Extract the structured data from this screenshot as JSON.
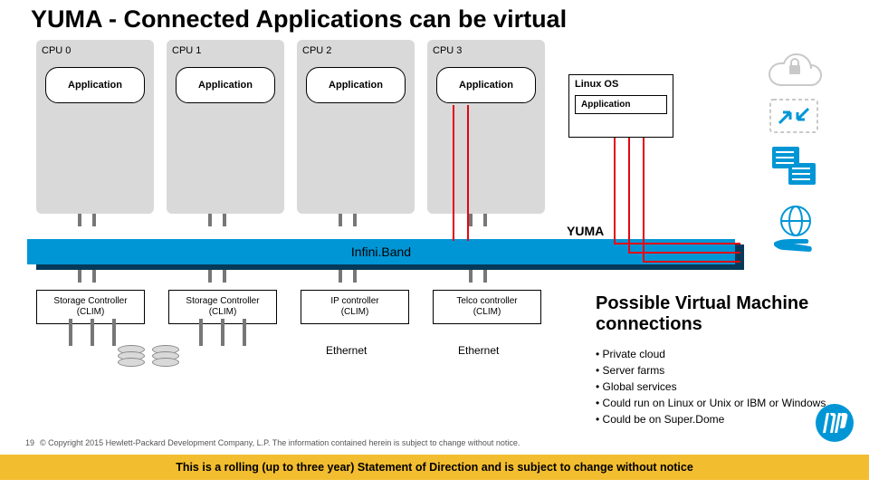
{
  "title": "YUMA - Connected Applications can be virtual",
  "cpus": [
    {
      "label": "CPU 0",
      "app": "Application"
    },
    {
      "label": "CPU 1",
      "app": "Application"
    },
    {
      "label": "CPU 2",
      "app": "Application"
    },
    {
      "label": "CPU 3",
      "app": "Application"
    }
  ],
  "linux": {
    "os": "Linux OS",
    "app": "Application"
  },
  "yuma_label": "YUMA",
  "bus_label": "Infini.Band",
  "controllers": [
    {
      "line1": "Storage Controller",
      "line2": "(CLIM)"
    },
    {
      "line1": "Storage Controller",
      "line2": "(CLIM)"
    },
    {
      "line1": "IP  controller",
      "line2": "(CLIM)"
    },
    {
      "line1": "Telco  controller",
      "line2": "(CLIM)"
    }
  ],
  "ethernet_label": "Ethernet",
  "pvm_heading": "Possible Virtual Machine connections",
  "bullets": [
    "Private cloud",
    "Server farms",
    "Global services",
    "Could run on Linux or Unix or IBM or Windows",
    "Could be on Super.Dome"
  ],
  "page_number": "19",
  "copyright": "© Copyright 2015 Hewlett-Packard Development Company, L.P.  The information contained herein is subject to change without notice.",
  "banner": "This is a rolling (up to three year) Statement of Direction and is subject to change without notice",
  "colors": {
    "accent": "#0096d6",
    "banner": "#f2bd2f",
    "red": "#e30613"
  }
}
